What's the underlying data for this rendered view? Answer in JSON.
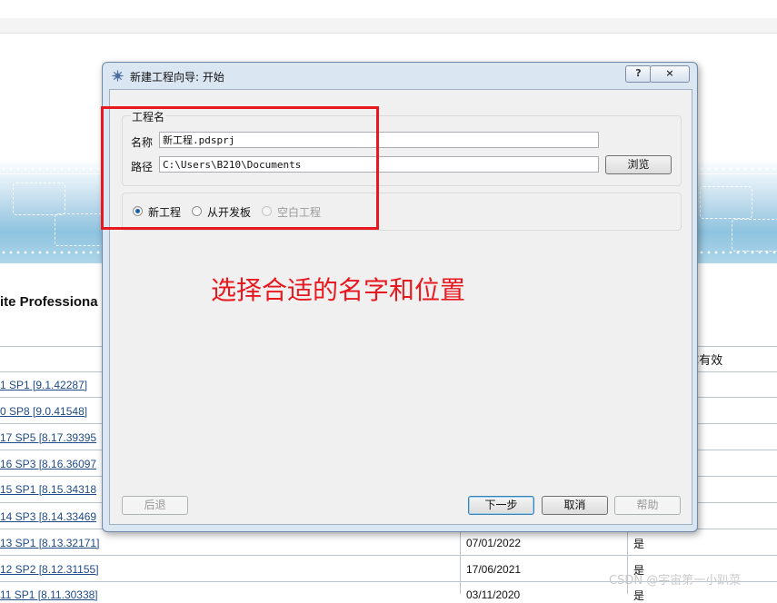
{
  "background_page": {
    "product_title": "ite Professiona",
    "table_header_partial": "C有效",
    "rows": [
      {
        "version": "1 SP1 [9.1.42287]",
        "date": "",
        "valid": ""
      },
      {
        "version": "0 SP8 [9.0.41548]",
        "date": "",
        "valid": ""
      },
      {
        "version": "17 SP5 [8.17.39395",
        "date": "",
        "valid": ""
      },
      {
        "version": "16 SP3 [8.16.36097",
        "date": "",
        "valid": ""
      },
      {
        "version": "15 SP1 [8.15.34318",
        "date": "",
        "valid": ""
      },
      {
        "version": "14 SP3 [8.14.33469",
        "date": "",
        "valid": ""
      },
      {
        "version": "13 SP1 [8.13.32171]",
        "date": "07/01/2022",
        "valid": "是"
      },
      {
        "version": "12 SP2 [8.12.31155]",
        "date": "17/06/2021",
        "valid": "是"
      },
      {
        "version": "11 SP1 [8.11.30338]",
        "date": "03/11/2020",
        "valid": "是"
      }
    ],
    "watermark": "CSDN @宇宙第一小趴菜"
  },
  "dialog": {
    "title": "新建工程向导: 开始",
    "help_button": "?",
    "close_button": "×",
    "group_title": "工程名",
    "name_label": "名称",
    "name_value": "新工程.pdsprj",
    "path_label": "路径",
    "path_value": "C:\\Users\\B210\\Documents",
    "browse_button": "浏览",
    "radios": [
      {
        "label": "新工程",
        "checked": true,
        "enabled": true
      },
      {
        "label": "从开发板",
        "checked": false,
        "enabled": true
      },
      {
        "label": "空白工程",
        "checked": false,
        "enabled": false
      }
    ],
    "back_button": "后退",
    "next_button": "下一步",
    "cancel_button": "取消",
    "help_text_button": "帮助"
  },
  "annotation": {
    "text": "选择合适的名字和位置",
    "color": "#e8191e"
  }
}
